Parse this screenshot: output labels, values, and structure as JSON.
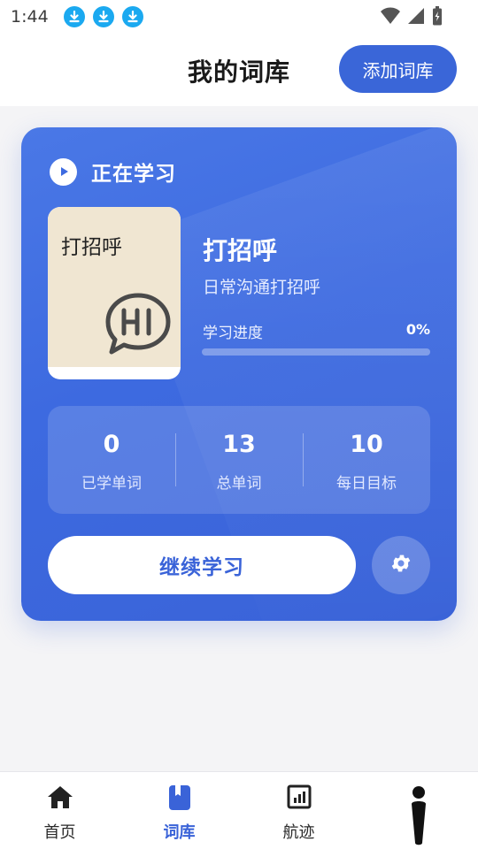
{
  "status_bar": {
    "time": "1:44",
    "download_icons": [
      "download-icon",
      "download-icon",
      "download-icon"
    ],
    "right_icons": [
      "wifi-icon",
      "signal-icon",
      "battery-icon"
    ]
  },
  "header": {
    "title": "我的词库",
    "add_button": "添加词库"
  },
  "card": {
    "status_label": "正在学习",
    "book_cover": {
      "title": "打招呼",
      "icon": "hi-speech-bubble-icon",
      "color": "#f0e6d2"
    },
    "deck_name": "打招呼",
    "deck_description": "日常沟通打招呼",
    "progress_label": "学习进度",
    "progress_value": "0%",
    "progress_fraction": 0,
    "stats": [
      {
        "value": "0",
        "label": "已学单词"
      },
      {
        "value": "13",
        "label": "总单词"
      },
      {
        "value": "10",
        "label": "每日目标"
      }
    ],
    "continue_button": "继续学习",
    "settings_icon": "gear-icon"
  },
  "bottom_nav": {
    "items": [
      {
        "label": "首页",
        "icon": "home-icon",
        "active": false
      },
      {
        "label": "词库",
        "icon": "bookmark-icon",
        "active": true
      },
      {
        "label": "航迹",
        "icon": "chart-icon",
        "active": false
      },
      {
        "label": "",
        "icon": "person-icon",
        "active": false
      }
    ]
  },
  "colors": {
    "accent": "#3a63d8",
    "background": "#f4f4f6",
    "download_badge": "#1ba9f0"
  }
}
